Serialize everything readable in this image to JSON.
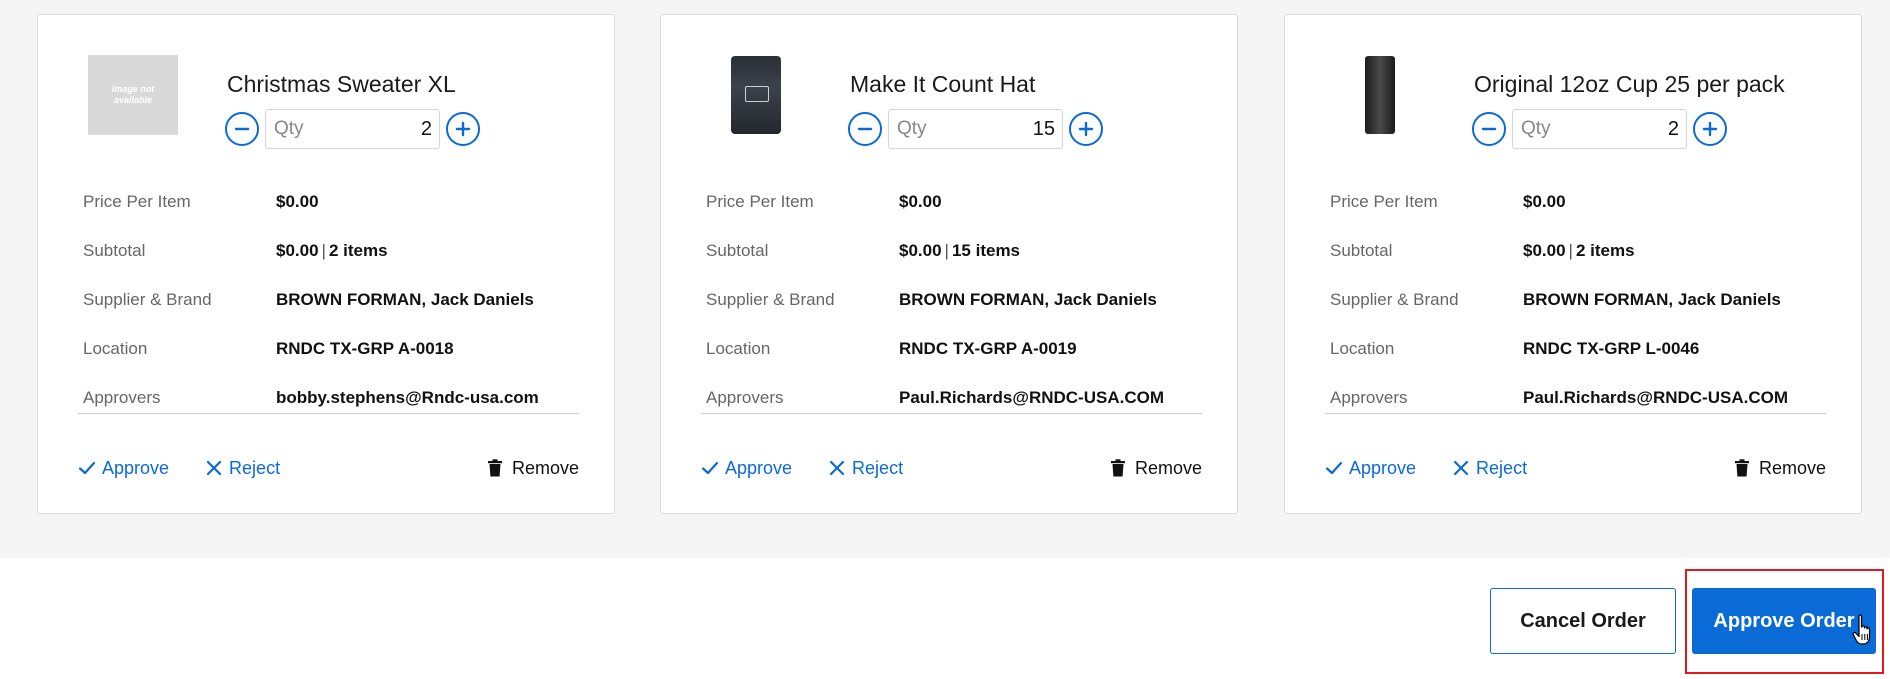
{
  "cards": [
    {
      "title": "Christmas Sweater XL",
      "image": "image-not-available",
      "image_text": "Image not available",
      "qty_placeholder": "Qty",
      "qty": "2",
      "price_label": "Price Per Item",
      "price": "$0.00",
      "subtotal_label": "Subtotal",
      "subtotal_amount": "$0.00",
      "subtotal_sep": "|",
      "subtotal_items": "2 items",
      "supplier_label": "Supplier & Brand",
      "supplier": "BROWN FORMAN, Jack Daniels",
      "location_label": "Location",
      "location": "RNDC TX-GRP A-0018",
      "approvers_label": "Approvers",
      "approvers": "bobby.stephens@Rndc-usa.com",
      "approve": "Approve",
      "reject": "Reject",
      "remove": "Remove"
    },
    {
      "title": "Make It Count Hat",
      "image": "hat-photo",
      "qty_placeholder": "Qty",
      "qty": "15",
      "price_label": "Price Per Item",
      "price": "$0.00",
      "subtotal_label": "Subtotal",
      "subtotal_amount": "$0.00",
      "subtotal_sep": "|",
      "subtotal_items": "15 items",
      "supplier_label": "Supplier & Brand",
      "supplier": "BROWN FORMAN, Jack Daniels",
      "location_label": "Location",
      "location": "RNDC TX-GRP A-0019",
      "approvers_label": "Approvers",
      "approvers": "Paul.Richards@RNDC-USA.COM",
      "approve": "Approve",
      "reject": "Reject",
      "remove": "Remove"
    },
    {
      "title": "Original 12oz Cup 25 per pack",
      "image": "cup-photo",
      "qty_placeholder": "Qty",
      "qty": "2",
      "price_label": "Price Per Item",
      "price": "$0.00",
      "subtotal_label": "Subtotal",
      "subtotal_amount": "$0.00",
      "subtotal_sep": "|",
      "subtotal_items": "2 items",
      "supplier_label": "Supplier & Brand",
      "supplier": "BROWN FORMAN, Jack Daniels",
      "location_label": "Location",
      "location": "RNDC TX-GRP L-0046",
      "approvers_label": "Approvers",
      "approvers": "Paul.Richards@RNDC-USA.COM",
      "approve": "Approve",
      "reject": "Reject",
      "remove": "Remove"
    }
  ],
  "footer": {
    "cancel_label": "Cancel Order",
    "approve_label": "Approve Order"
  },
  "colors": {
    "accent": "#0a6ad6",
    "background": "#f5f5f5",
    "highlight": "#e0191f"
  }
}
